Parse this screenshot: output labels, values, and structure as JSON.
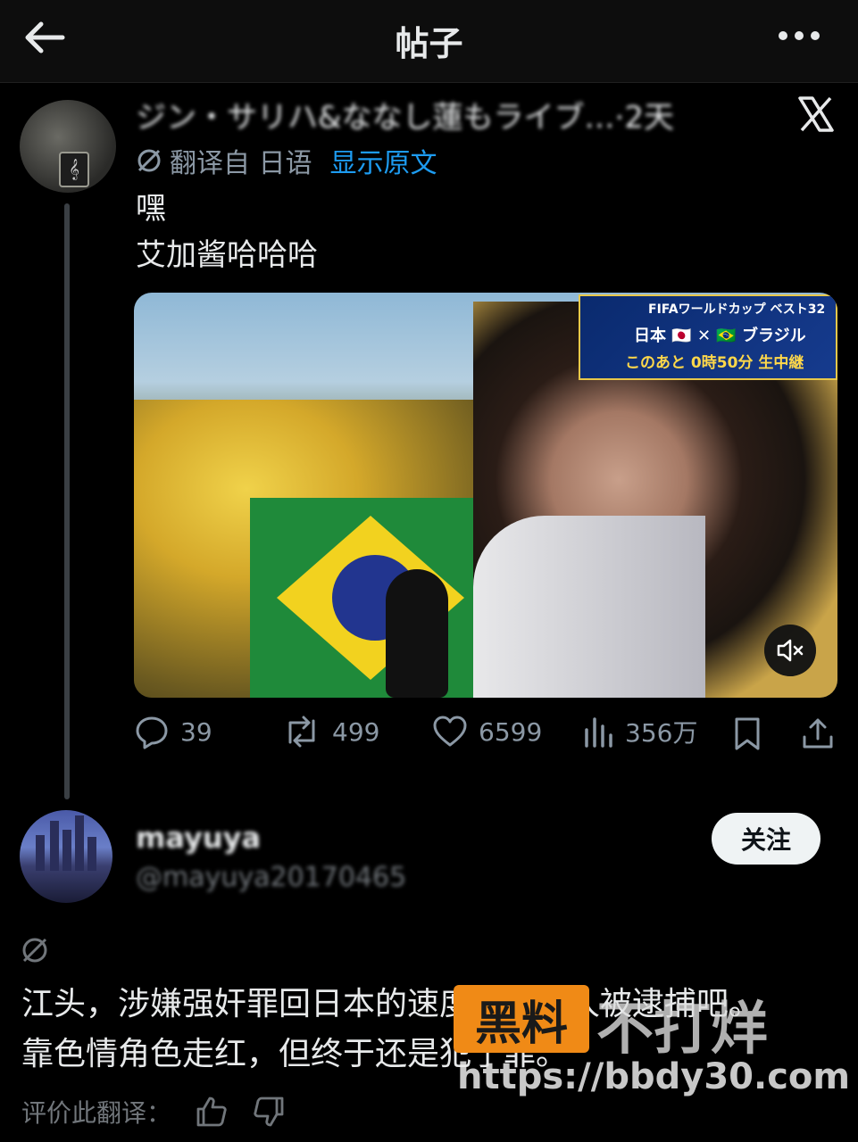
{
  "topbar": {
    "title": "帖子"
  },
  "post": {
    "author_line": "ジン・サリハ&ななし蓮もライブ…·2天",
    "translated_label": "翻译自 日语",
    "show_original": "显示原文",
    "text_line1": "嘿",
    "text_line2": "艾加酱哈哈哈",
    "banner": {
      "line1": "FIFAワールドカップ ベスト32",
      "line2": "日本 🇯🇵 ✕ 🇧🇷 ブラジル",
      "line3": "このあと 0時50分 生中継"
    },
    "actions": {
      "replies": "39",
      "reposts": "499",
      "likes": "6599",
      "views": "356万"
    }
  },
  "reply": {
    "name": "mayuya",
    "handle": "@mayuya20170465",
    "follow_label": "关注",
    "text_line1": "江头，涉嫌强奸罪回日本的速度比较家人被逮捕吧。",
    "text_line2": "靠色情角色走红，但终于还是犯了罪。",
    "rate_label": "评价此翻译："
  },
  "watermark": {
    "box": "黑料",
    "text": "不打烊",
    "url": "https://bbdy30.com"
  }
}
